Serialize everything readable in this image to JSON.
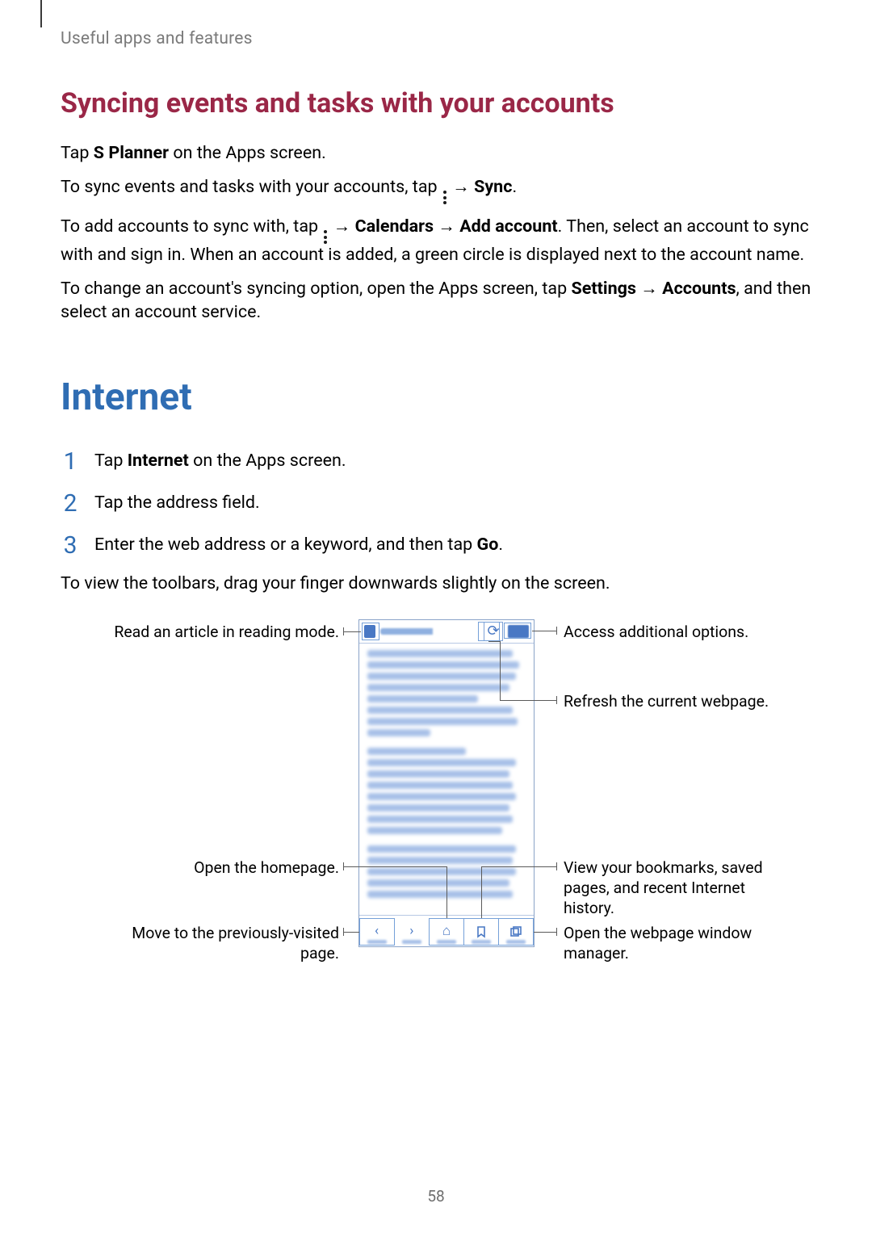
{
  "header": "Useful apps and features",
  "section1": {
    "title": "Syncing events and tasks with your accounts",
    "p1_prefix": "Tap ",
    "p1_bold": "S Planner",
    "p1_suffix": " on the Apps screen.",
    "p2_prefix": "To sync events and tasks with your accounts, tap ",
    "p2_arrow": " → ",
    "p2_bold": "Sync",
    "p2_suffix": ".",
    "p3_prefix": "To add accounts to sync with, tap ",
    "p3_arrow1": " → ",
    "p3_bold1": "Calendars",
    "p3_arrow2": " → ",
    "p3_bold2": "Add account",
    "p3_suffix": ". Then, select an account to sync with and sign in. When an account is added, a green circle is displayed next to the account name.",
    "p4_prefix": "To change an account's syncing option, open the Apps screen, tap ",
    "p4_bold1": "Settings",
    "p4_arrow": " → ",
    "p4_bold2": "Accounts",
    "p4_suffix": ", and then select an account service."
  },
  "section2": {
    "title": "Internet",
    "steps": {
      "n1": "1",
      "t1_prefix": "Tap ",
      "t1_bold": "Internet",
      "t1_suffix": " on the Apps screen.",
      "n2": "2",
      "t2": "Tap the address field.",
      "n3": "3",
      "t3_prefix": "Enter the web address or a keyword, and then tap ",
      "t3_bold": "Go",
      "t3_suffix": "."
    },
    "after": "To view the toolbars, drag your finger downwards slightly on the screen."
  },
  "callouts": {
    "reader": "Read an article in reading mode.",
    "more": "Access additional options.",
    "refresh": "Refresh the current webpage.",
    "home": "Open the homepage.",
    "bookmarks": "View your bookmarks, saved pages, and recent Internet history.",
    "back": "Move to the previously-visited page.",
    "windows": "Open the webpage window manager."
  },
  "page_number": "58"
}
